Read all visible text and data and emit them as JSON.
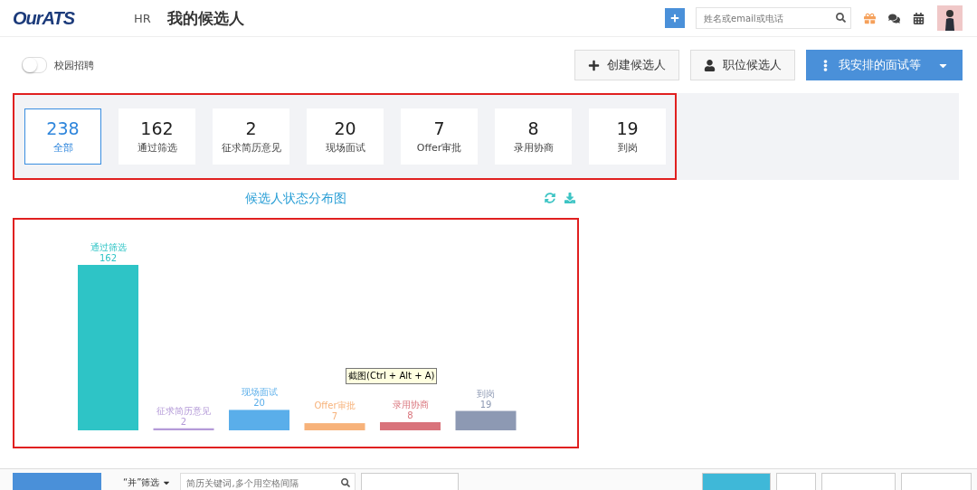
{
  "header": {
    "logo": "OurATS",
    "role": "HR",
    "title": "我的候选人",
    "search": {
      "placeholder": "姓名或email或电话"
    }
  },
  "toolbar": {
    "campus_toggle": {
      "label": "校园招聘",
      "on": false
    },
    "buttons": [
      {
        "label": "创建候选人",
        "kind": "create"
      },
      {
        "label": "职位候选人",
        "kind": "person"
      },
      {
        "label": "我安排的面试等",
        "kind": "menu"
      }
    ]
  },
  "stats": [
    {
      "count": "238",
      "label": "全部",
      "selected": true
    },
    {
      "count": "162",
      "label": "通过筛选",
      "selected": false
    },
    {
      "count": "2",
      "label": "征求简历意见",
      "selected": false
    },
    {
      "count": "20",
      "label": "现场面试",
      "selected": false
    },
    {
      "count": "7",
      "label": "Offer审批",
      "selected": false
    },
    {
      "count": "8",
      "label": "录用协商",
      "selected": false
    },
    {
      "count": "19",
      "label": "到岗",
      "selected": false
    }
  ],
  "chart": {
    "title": "候选人状态分布图",
    "tooltip": "截图(Ctrl + Alt + A)",
    "chart_data": {
      "type": "bar",
      "data_labels": true,
      "categories": [
        "通过筛选",
        "征求简历意见",
        "现场面试",
        "Offer审批",
        "录用协商",
        "到岗"
      ],
      "colors": [
        "#2ec4c6",
        "#b49ad8",
        "#5aaeea",
        "#f7b27a",
        "#d9737b",
        "#8d99b3"
      ],
      "series": [
        {
          "values": [
            162,
            2,
            20,
            7,
            8,
            19
          ]
        }
      ]
    }
  },
  "filter_bar": {
    "mode": "“并”筛选",
    "keyword": {
      "placeholder": "简历关键词,多个用空格间隔"
    }
  }
}
